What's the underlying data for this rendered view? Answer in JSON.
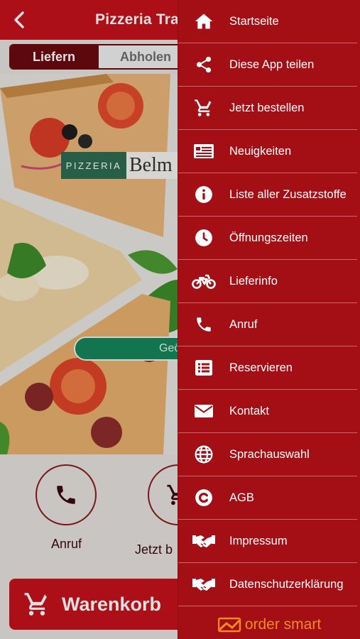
{
  "header": {
    "title": "Pizzeria Tratto"
  },
  "order_mode": {
    "delivery": "Liefern",
    "pickup": "Abholen"
  },
  "hero": {
    "logo_left": "PIZZERIA",
    "logo_right": "Belm",
    "pill": "Geö"
  },
  "actions": [
    {
      "label": "Anruf",
      "icon": "phone-icon"
    },
    {
      "label": "Jetzt b",
      "icon": "cart-icon"
    }
  ],
  "cart": {
    "label": "Warenkorb"
  },
  "menu": {
    "items": [
      {
        "label": "Startseite",
        "icon": "home-icon"
      },
      {
        "label": "Diese App teilen",
        "icon": "share-icon"
      },
      {
        "label": "Jetzt bestellen",
        "icon": "cart-icon"
      },
      {
        "label": "Neuigkeiten",
        "icon": "news-icon"
      },
      {
        "label": "Liste aller Zusatzstoffe",
        "icon": "info-icon"
      },
      {
        "label": "Öffnungszeiten",
        "icon": "clock-icon"
      },
      {
        "label": "Lieferinfo",
        "icon": "motorbike-icon"
      },
      {
        "label": "Anruf",
        "icon": "phone-icon"
      },
      {
        "label": "Reservieren",
        "icon": "list-icon"
      },
      {
        "label": "Kontakt",
        "icon": "envelope-icon"
      },
      {
        "label": "Sprachauswahl",
        "icon": "globe-icon"
      },
      {
        "label": "AGB",
        "icon": "copyright-icon"
      },
      {
        "label": "Impressum",
        "icon": "handshake-icon"
      },
      {
        "label": "Datenschutzerklärung",
        "icon": "handshake-icon"
      }
    ],
    "brand": "order smart"
  },
  "colors": {
    "header_red": "#c5121d",
    "menu_red": "#a40f16",
    "dark_red": "#6a0a0e",
    "green": "#16865c",
    "brand_orange": "#f28a24"
  }
}
